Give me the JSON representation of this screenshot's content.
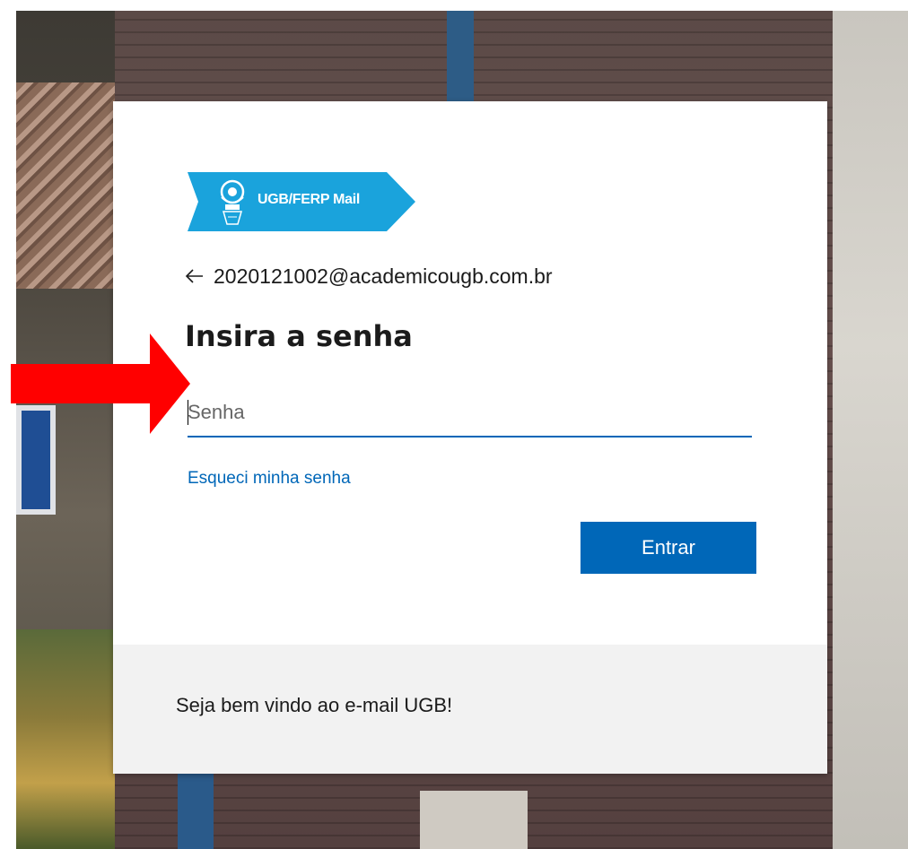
{
  "background": {
    "description_colors": {
      "brick": "#5b4a47",
      "blue_post": "#1f4e94"
    }
  },
  "logo": {
    "text": "UGB/FERP Mail",
    "banner_color": "#1aa3dc",
    "emblem_icon": "ugb-emblem-icon"
  },
  "identity": {
    "back_icon": "arrow-left-icon",
    "email": "2020121002@academicougb.com.br"
  },
  "title": "Insira a senha",
  "password": {
    "value": "",
    "placeholder": "Senha",
    "accent_color": "#0067b8"
  },
  "forgot_link": "Esqueci minha senha",
  "submit": {
    "label": "Entrar",
    "color": "#0067b8"
  },
  "footer": {
    "text": "Seja bem vindo ao e-mail UGB!"
  },
  "annotation": {
    "arrow_icon": "red-arrow-right-icon",
    "color": "#ff0000"
  }
}
